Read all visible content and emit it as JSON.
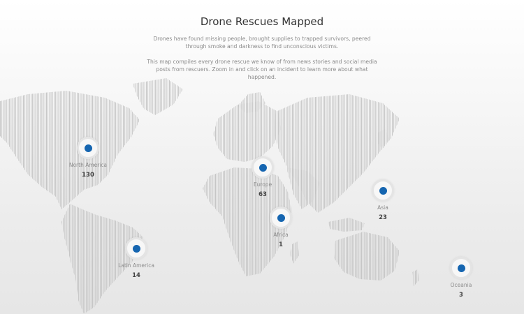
{
  "header": {
    "title": "Drone Rescues Mapped",
    "paragraph1": "Drones have found missing people, brought supplies to trapped survivors, peered through smoke and darkness to find unconscious victims.",
    "paragraph2": "This map compiles every drone rescue we know of from news stories and social media posts from rescuers. Zoom in and click on an incident to learn more about what happened."
  },
  "colors": {
    "accent": "#1565b0",
    "map_lines": "#b9b9b9"
  },
  "markers": [
    {
      "region": "North America",
      "count": "130"
    },
    {
      "region": "Europe",
      "count": "63"
    },
    {
      "region": "Africa",
      "count": "1"
    },
    {
      "region": "Asia",
      "count": "23"
    },
    {
      "region": "Latin America",
      "count": "14"
    },
    {
      "region": "Oceania",
      "count": "3"
    }
  ]
}
